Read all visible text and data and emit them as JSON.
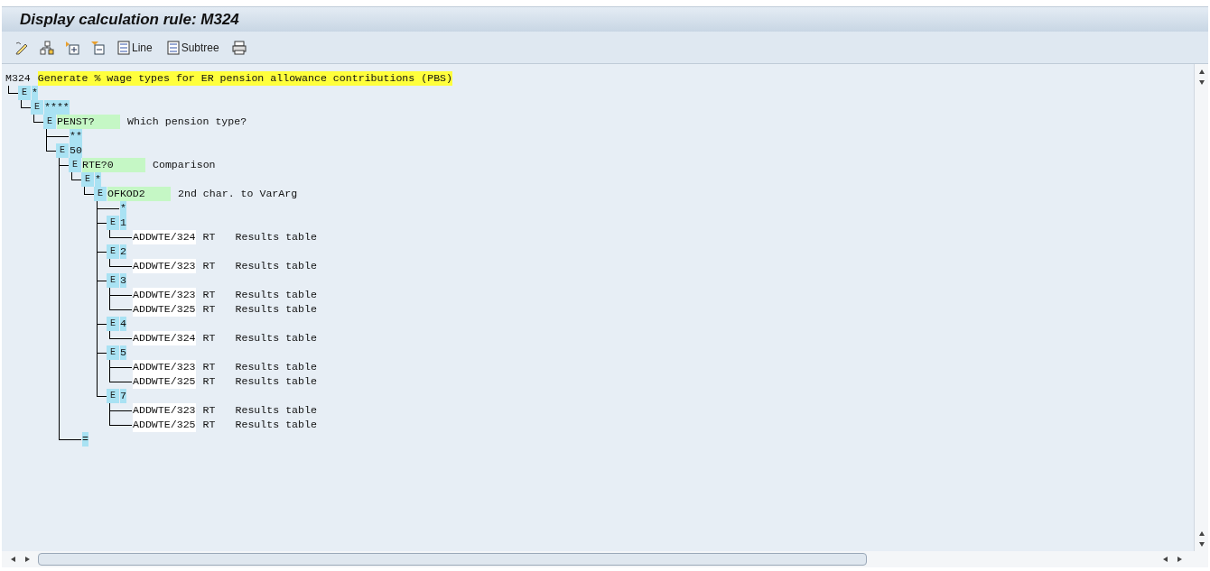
{
  "window": {
    "title": "Display calculation rule: M324"
  },
  "toolbar": [
    {
      "kind": "icon"
    },
    {
      "kind": "icon"
    },
    {
      "kind": "icon"
    },
    {
      "kind": "icon"
    },
    {
      "kind": "button",
      "label": "Line"
    },
    {
      "kind": "button",
      "label": "Subtree"
    },
    {
      "kind": "icon"
    }
  ],
  "rule": {
    "code": "M324",
    "description": "Generate % wage types for ER pension allowance contributions (PBS)",
    "children": [
      {
        "marker": "E",
        "code": "*",
        "kind": "cyan",
        "children": [
          {
            "marker": "E",
            "code": "****",
            "kind": "cyan",
            "children": [
              {
                "marker": "E",
                "code": "PENST?",
                "kind": "green",
                "description": "Which pension type?",
                "children": [
                  {
                    "code": "**",
                    "kind": "cyan"
                  },
                  {
                    "marker": "E",
                    "code": "50",
                    "kind": "cyan",
                    "children": [
                      {
                        "marker": "E",
                        "code": "RTE?0",
                        "kind": "green",
                        "description": "Comparison",
                        "children": [
                          {
                            "marker": "E",
                            "code": "*",
                            "kind": "cyan",
                            "children": [
                              {
                                "marker": "E",
                                "code": "OFKOD2",
                                "kind": "green",
                                "description": "2nd char. to VarArg",
                                "children": [
                                  {
                                    "code": "*",
                                    "kind": "cyan"
                                  },
                                  {
                                    "marker": "E",
                                    "code": "1",
                                    "kind": "cyan",
                                    "children": [
                                      {
                                        "code": "ADDWTE/324",
                                        "kind": "white",
                                        "param": "RT",
                                        "description": "Results table"
                                      }
                                    ]
                                  },
                                  {
                                    "marker": "E",
                                    "code": "2",
                                    "kind": "cyan",
                                    "children": [
                                      {
                                        "code": "ADDWTE/323",
                                        "kind": "white",
                                        "param": "RT",
                                        "description": "Results table"
                                      }
                                    ]
                                  },
                                  {
                                    "marker": "E",
                                    "code": "3",
                                    "kind": "cyan",
                                    "children": [
                                      {
                                        "code": "ADDWTE/323",
                                        "kind": "white",
                                        "param": "RT",
                                        "description": "Results table"
                                      },
                                      {
                                        "code": "ADDWTE/325",
                                        "kind": "white",
                                        "param": "RT",
                                        "description": "Results table"
                                      }
                                    ]
                                  },
                                  {
                                    "marker": "E",
                                    "code": "4",
                                    "kind": "cyan",
                                    "children": [
                                      {
                                        "code": "ADDWTE/324",
                                        "kind": "white",
                                        "param": "RT",
                                        "description": "Results table"
                                      }
                                    ]
                                  },
                                  {
                                    "marker": "E",
                                    "code": "5",
                                    "kind": "cyan",
                                    "children": [
                                      {
                                        "code": "ADDWTE/323",
                                        "kind": "white",
                                        "param": "RT",
                                        "description": "Results table"
                                      },
                                      {
                                        "code": "ADDWTE/325",
                                        "kind": "white",
                                        "param": "RT",
                                        "description": "Results table"
                                      }
                                    ]
                                  },
                                  {
                                    "marker": "E",
                                    "code": "7",
                                    "kind": "cyan",
                                    "children": [
                                      {
                                        "code": "ADDWTE/323",
                                        "kind": "white",
                                        "param": "RT",
                                        "description": "Results table"
                                      },
                                      {
                                        "code": "ADDWTE/325",
                                        "kind": "white",
                                        "param": "RT",
                                        "description": "Results table"
                                      }
                                    ]
                                  }
                                ]
                              }
                            ]
                          }
                        ]
                      },
                      {
                        "code": "=",
                        "kind": "cyan"
                      }
                    ]
                  }
                ]
              }
            ]
          }
        ]
      }
    ]
  }
}
